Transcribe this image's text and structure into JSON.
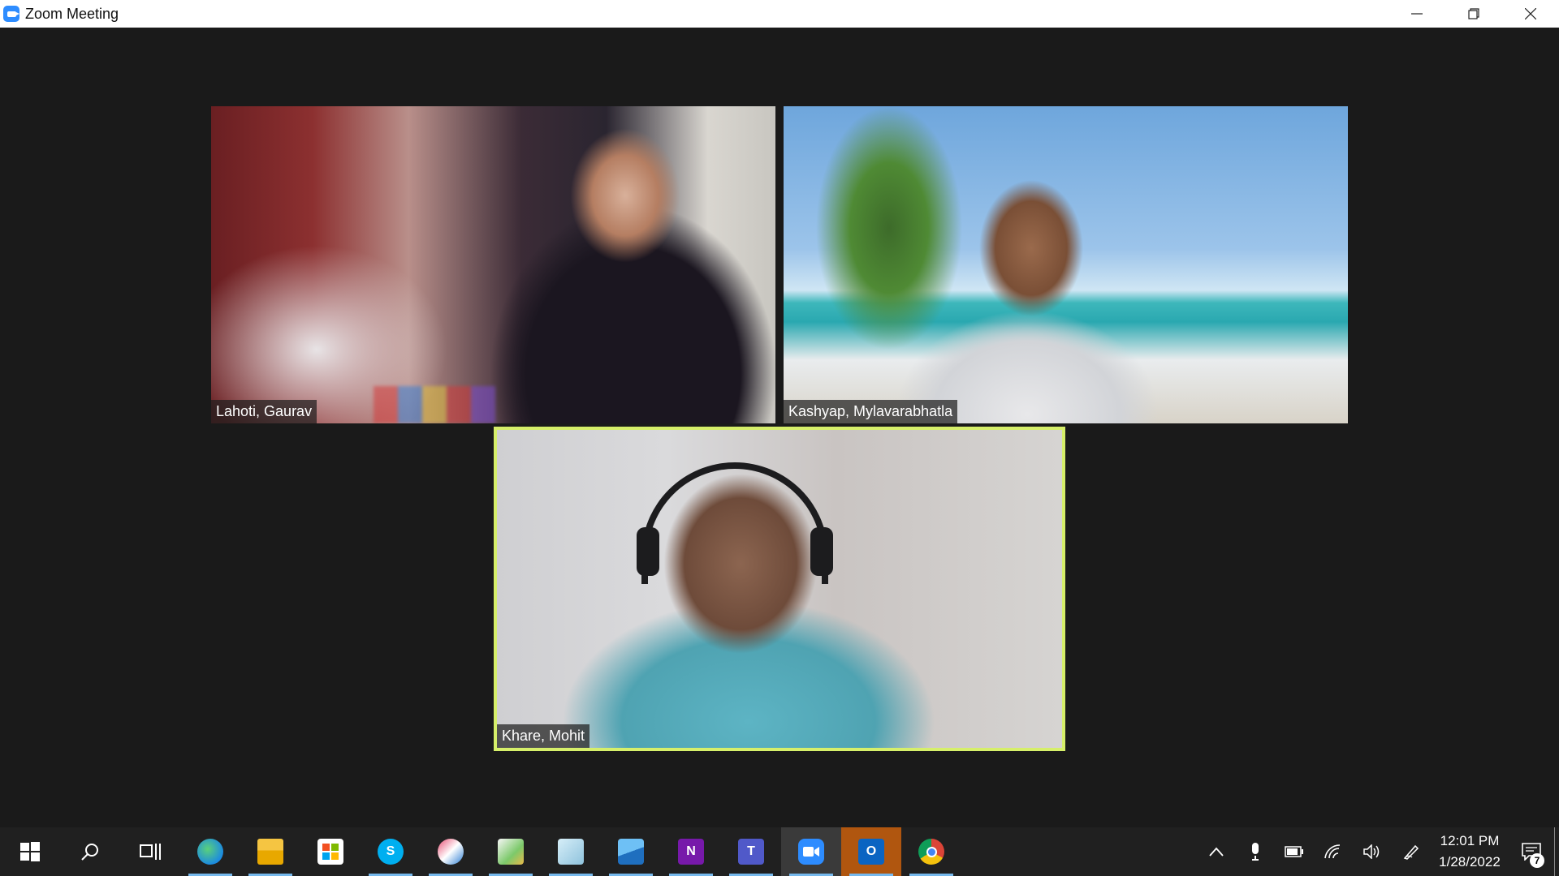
{
  "window": {
    "title": "Zoom Meeting",
    "controls": {
      "minimize": "minimize-icon",
      "restore": "restore-icon",
      "close": "close-icon"
    }
  },
  "meeting": {
    "participants": [
      {
        "name": "Lahoti, Gaurav",
        "active_speaker": false
      },
      {
        "name": "Kashyap, Mylavarabhatla",
        "active_speaker": false
      },
      {
        "name": "Khare, Mohit",
        "active_speaker": true
      }
    ],
    "active_speaker_color": "#d6ef6a"
  },
  "taskbar": {
    "apps": [
      {
        "name": "start-icon",
        "running": false
      },
      {
        "name": "search-icon",
        "running": false
      },
      {
        "name": "task-view-icon",
        "running": false
      },
      {
        "name": "edge-icon",
        "running": true
      },
      {
        "name": "file-explorer-icon",
        "running": true
      },
      {
        "name": "microsoft-store-icon",
        "running": false
      },
      {
        "name": "skype-icon",
        "running": true
      },
      {
        "name": "snip-sketch-icon",
        "running": true
      },
      {
        "name": "paint-icon",
        "running": true
      },
      {
        "name": "notepad-icon",
        "running": true
      },
      {
        "name": "photos-icon",
        "running": true
      },
      {
        "name": "onenote-icon",
        "running": true
      },
      {
        "name": "teams-icon",
        "running": true
      },
      {
        "name": "zoom-icon",
        "running": true,
        "active": true
      },
      {
        "name": "outlook-icon",
        "running": true
      },
      {
        "name": "chrome-icon",
        "running": true
      }
    ],
    "tray": {
      "icons": [
        "chevron-up-icon",
        "microphone-icon",
        "battery-icon",
        "wifi-icon",
        "volume-icon",
        "pen-icon"
      ],
      "time": "12:01 PM",
      "date": "1/28/2022",
      "notification_count": "7"
    }
  }
}
